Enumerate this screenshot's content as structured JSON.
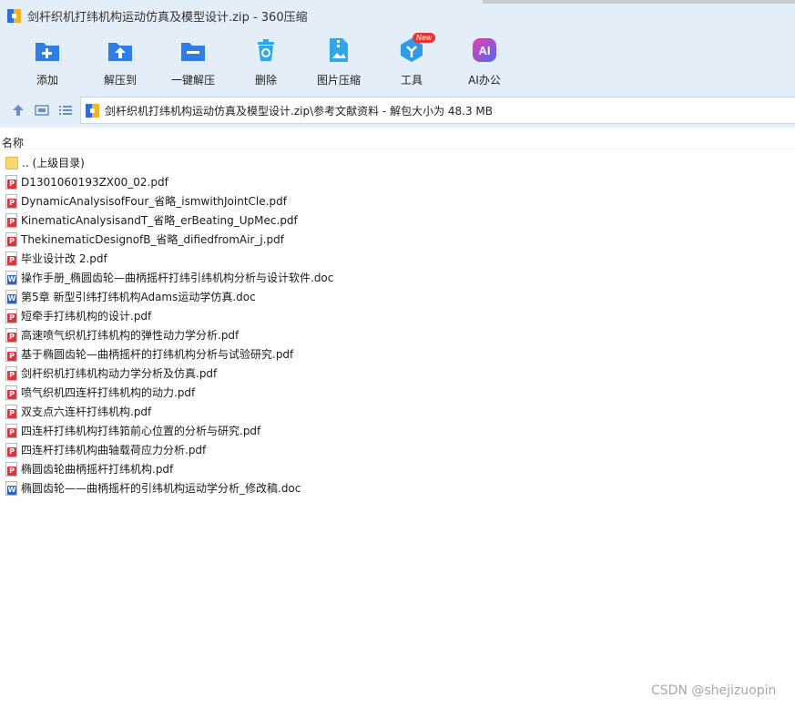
{
  "window": {
    "title": "剑杆织机打纬机构运动仿真及模型设计.zip - 360压缩"
  },
  "toolbar": {
    "items": [
      {
        "label": "添加",
        "icon": "add-folder-icon",
        "color": "#2f7ee8"
      },
      {
        "label": "解压到",
        "icon": "extract-to-folder-icon",
        "color": "#2f7ee8"
      },
      {
        "label": "一键解压",
        "icon": "one-click-extract-icon",
        "color": "#2f7ee8"
      },
      {
        "label": "删除",
        "icon": "delete-trash-icon",
        "color": "#2fa8e8"
      },
      {
        "label": "图片压缩",
        "icon": "image-compress-icon",
        "color": "#2fa8e8"
      },
      {
        "label": "工具",
        "icon": "tools-cube-icon",
        "color": "#2f9ae8",
        "badge": "New"
      },
      {
        "label": "AI办公",
        "icon": "ai-office-icon",
        "color": "#7a5cf0"
      }
    ]
  },
  "address": {
    "nav_icons": [
      "up-arrow-icon",
      "thumbnail-view-icon",
      "list-view-icon"
    ],
    "path": "剑杆织机打纬机构运动仿真及模型设计.zip\\参考文献资料 - 解包大小为 48.3 MB"
  },
  "list": {
    "header": "名称",
    "files": [
      {
        "name": ".. (上级目录)",
        "type": "folder"
      },
      {
        "name": "D1301060193ZX00_02.pdf",
        "type": "pdf"
      },
      {
        "name": "DynamicAnalysisofFour_省略_ismwithJointCle.pdf",
        "type": "pdf"
      },
      {
        "name": "KinematicAnalysisandT_省略_erBeating_UpMec.pdf",
        "type": "pdf"
      },
      {
        "name": "ThekinematicDesignofB_省略_difiedfromAir_j.pdf",
        "type": "pdf"
      },
      {
        "name": "毕业设计改 2.pdf",
        "type": "pdf"
      },
      {
        "name": "操作手册_椭圆齿轮—曲柄摇杆打纬引纬机构分析与设计软件.doc",
        "type": "doc"
      },
      {
        "name": "第5章 新型引纬打纬机构Adams运动学仿真.doc",
        "type": "doc"
      },
      {
        "name": "短牵手打纬机构的设计.pdf",
        "type": "pdf"
      },
      {
        "name": "高速喷气织机打纬机构的弹性动力学分析.pdf",
        "type": "pdf"
      },
      {
        "name": "基于椭圆齿轮—曲柄摇杆的打纬机构分析与试验研究.pdf",
        "type": "pdf"
      },
      {
        "name": "剑杆织机打纬机构动力学分析及仿真.pdf",
        "type": "pdf"
      },
      {
        "name": "喷气织机四连杆打纬机构的动力.pdf",
        "type": "pdf"
      },
      {
        "name": "双支点六连杆打纬机构.pdf",
        "type": "pdf"
      },
      {
        "name": "四连杆打纬机构打纬筘前心位置的分析与研究.pdf",
        "type": "pdf"
      },
      {
        "name": "四连杆打纬机构曲轴载荷应力分析.pdf",
        "type": "pdf"
      },
      {
        "name": "椭圆齿轮曲柄摇杆打纬机构.pdf",
        "type": "pdf"
      },
      {
        "name": "椭圆齿轮——曲柄摇杆的引纬机构运动学分析_修改稿.doc",
        "type": "doc"
      }
    ]
  },
  "watermark": "CSDN @shejizuopin"
}
